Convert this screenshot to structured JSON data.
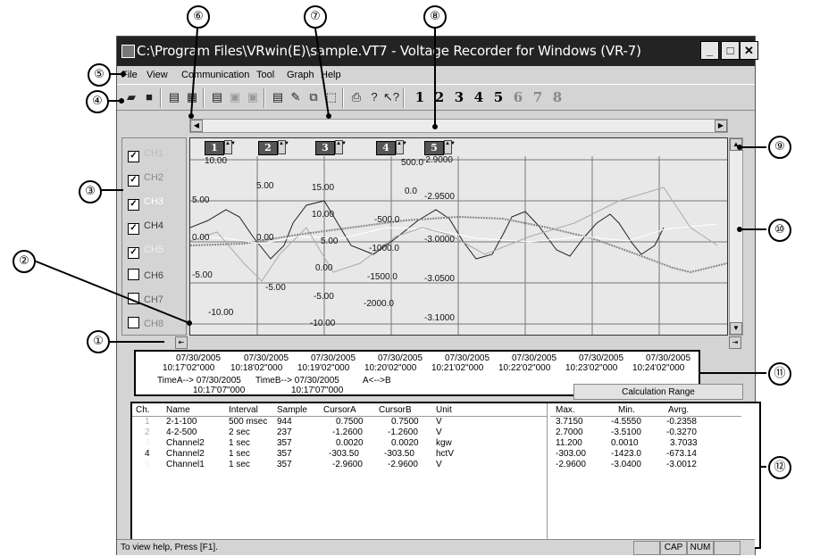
{
  "window": {
    "title": "C:\\Program Files\\VRwin(E)\\sample.VT7 - Voltage Recorder for Windows (VR-7)"
  },
  "menu": [
    "File",
    "View",
    "Communication",
    "Tool",
    "Graph",
    "Help"
  ],
  "toolbar": {
    "channel_buttons": [
      "1",
      "2",
      "3",
      "4",
      "5",
      "6",
      "7",
      "8"
    ]
  },
  "channels": [
    {
      "label": "CH1",
      "checked": true
    },
    {
      "label": "CH2",
      "checked": true
    },
    {
      "label": "CH3",
      "checked": true
    },
    {
      "label": "CH4",
      "checked": true
    },
    {
      "label": "CH5",
      "checked": true
    },
    {
      "label": "CH6",
      "checked": false
    },
    {
      "label": "CH7",
      "checked": false
    },
    {
      "label": "CH8",
      "checked": false
    }
  ],
  "axis_buttons": [
    "1",
    "2",
    "3",
    "4",
    "5"
  ],
  "axis_ticks": {
    "axis1": [
      "10.00",
      "5.00",
      "0.00",
      "-5.00",
      "-10.00"
    ],
    "axis2": [
      "5.00",
      "0.00",
      "-5.00"
    ],
    "axis3": [
      "15.00",
      "10.00",
      "5.00",
      "0.00",
      "-5.00",
      "-10.00"
    ],
    "axis4": [
      "500.0",
      "0.0",
      "-500.0",
      "-1000.0",
      "-1500.0",
      "-2000.0"
    ],
    "axis5": [
      "-2.9000",
      "-2.9500",
      "-3.0000",
      "-3.0500",
      "-3.1000"
    ]
  },
  "time_axis": [
    {
      "date": "07/30/2005",
      "time": "10:17'02\"000"
    },
    {
      "date": "07/30/2005",
      "time": "10:18'02\"000"
    },
    {
      "date": "07/30/2005",
      "time": "10:19'02\"000"
    },
    {
      "date": "07/30/2005",
      "time": "10:20'02\"000"
    },
    {
      "date": "07/30/2005",
      "time": "10:21'02\"000"
    },
    {
      "date": "07/30/2005",
      "time": "10:22'02\"000"
    },
    {
      "date": "07/30/2005",
      "time": "10:23'02\"000"
    },
    {
      "date": "07/30/2005",
      "time": "10:24'02\"000"
    }
  ],
  "cursors": {
    "time_a_label": "TimeA--> 07/30/2005",
    "time_a_time": "10:17'07\"000",
    "time_b_label": "TimeB--> 07/30/2005",
    "time_b_time": "10:17'07\"000",
    "diff_label": "A<-->B",
    "calc_range": "Calculation Range"
  },
  "table": {
    "headers": [
      "Ch.",
      "Name",
      "Interval",
      "Sample",
      "CursorA",
      "CursorB",
      "Unit"
    ],
    "stat_headers": [
      "Max.",
      "Min.",
      "Avrg."
    ],
    "rows": [
      {
        "ch": "1",
        "name": "2-1-100",
        "interval": "500 msec",
        "sample": "944",
        "cursorA": "0.7500",
        "cursorB": "0.7500",
        "unit": "V",
        "max": "3.7150",
        "min": "-4.5550",
        "avg": "-0.2358"
      },
      {
        "ch": "2",
        "name": "4-2-500",
        "interval": "2 sec",
        "sample": "237",
        "cursorA": "-1.2600",
        "cursorB": "-1.2600",
        "unit": "V",
        "max": "2.7000",
        "min": "-3.5100",
        "avg": "-0.3270"
      },
      {
        "ch": "3",
        "name": "Channel2",
        "interval": "1 sec",
        "sample": "357",
        "cursorA": "0.0020",
        "cursorB": "0.0020",
        "unit": "kgw",
        "max": "11.200",
        "min": "0.0010",
        "avg": "3.7033"
      },
      {
        "ch": "4",
        "name": "Channel2",
        "interval": "1 sec",
        "sample": "357",
        "cursorA": "-303.50",
        "cursorB": "-303.50",
        "unit": "hctV",
        "max": "-303.00",
        "min": "-1423.0",
        "avg": "-673.14"
      },
      {
        "ch": "5",
        "name": "Channel1",
        "interval": "1 sec",
        "sample": "357",
        "cursorA": "-2.9600",
        "cursorB": "-2.9600",
        "unit": "V",
        "max": "-2.9600",
        "min": "-3.0400",
        "avg": "-3.0012"
      }
    ]
  },
  "status": {
    "help": "To view help, Press [F1].",
    "cap": "CAP",
    "num": "NUM"
  },
  "callouts": [
    "①",
    "②",
    "③",
    "④",
    "⑤",
    "⑥",
    "⑦",
    "⑧",
    "⑨",
    "⑩",
    "⑪",
    "⑫"
  ]
}
